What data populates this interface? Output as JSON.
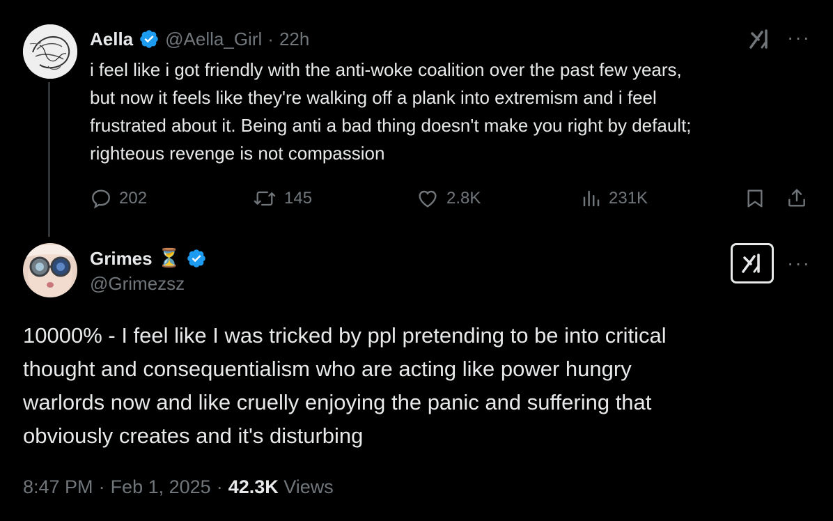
{
  "tweet1": {
    "display_name": "Aella",
    "handle": "@Aella_Girl",
    "separator": "·",
    "time": "22h",
    "text": "i feel like i got friendly with the anti-woke coalition over the past few years, but now it feels like they're walking off a plank into extremism and i feel frustrated about it. Being anti a bad thing doesn't make you right by default; righteous revenge is not compassion",
    "text_lines": [
      "i feel like i got friendly with the anti-woke coalition over the past few years,",
      "but now it feels like they're walking off a plank into extremism and i feel",
      "frustrated about it. Being anti a bad thing doesn't make you right by default;",
      "righteous revenge is not compassion"
    ],
    "replies": "202",
    "reposts": "145",
    "likes": "2.8K",
    "views": "231K",
    "more_label": "···",
    "icons": [
      "grok-icon",
      "more-icon",
      "reply-icon",
      "repost-icon",
      "like-icon",
      "views-icon",
      "bookmark-icon",
      "share-icon",
      "verified-badge-icon"
    ]
  },
  "tweet2": {
    "display_name": "Grimes",
    "emoji": "⏳",
    "handle": "@Grimezsz",
    "more_label": "···",
    "text_lines": [
      "10000% - I feel like I was tricked by ppl pretending to be into critical",
      "thought and consequentialism who are acting like power hungry",
      "warlords now and like cruelly enjoying the panic and suffering that",
      "obviously creates and it's disturbing"
    ],
    "footer": {
      "time": "8:47 PM",
      "sep1": "·",
      "date": "Feb 1, 2025",
      "sep2": "·",
      "views_count": "42.3K",
      "views_label": "Views"
    }
  },
  "colors": {
    "background": "#000000",
    "text": "#e7e9ea",
    "muted": "#71767b",
    "verified": "#1d9bf0"
  }
}
